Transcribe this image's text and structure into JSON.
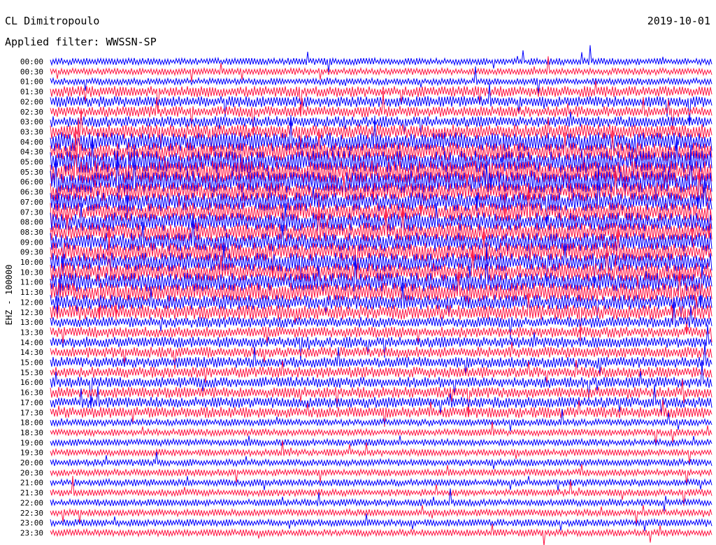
{
  "header": {
    "station": "CL Dimitropoulo",
    "filter": "Applied filter: WWSSN-SP",
    "date": "2019-10-01"
  },
  "chart_data": {
    "type": "line",
    "title": "CL Dimitropoulo",
    "subtitle": "Applied filter: WWSSN-SP",
    "ylabel": "EHZ - 100000",
    "date": "2019-10-01",
    "rows": [
      "00:00",
      "00:30",
      "01:00",
      "01:30",
      "02:00",
      "02:30",
      "03:00",
      "03:30",
      "04:00",
      "04:30",
      "05:00",
      "05:30",
      "06:00",
      "06:30",
      "07:00",
      "07:30",
      "08:00",
      "08:30",
      "09:00",
      "09:30",
      "10:00",
      "10:30",
      "11:00",
      "11:30",
      "12:00",
      "12:30",
      "13:00",
      "13:30",
      "14:00",
      "14:30",
      "15:00",
      "15:30",
      "16:00",
      "16:30",
      "17:00",
      "17:30",
      "18:00",
      "18:30",
      "19:00",
      "19:30",
      "20:00",
      "20:30",
      "21:00",
      "21:30",
      "22:00",
      "22:30",
      "23:00",
      "23:30"
    ],
    "row_amplitude_level": [
      1,
      1,
      1,
      2,
      2,
      2,
      2,
      3,
      4,
      4,
      5,
      5,
      5,
      4,
      4,
      4,
      4,
      4,
      4,
      4,
      4,
      4,
      4,
      4,
      3,
      3,
      2,
      2,
      2,
      2,
      2,
      2,
      2,
      2,
      2,
      2,
      1,
      1,
      1,
      1,
      1,
      1,
      1,
      1,
      1,
      1,
      1,
      1
    ],
    "series_colors": [
      "#0000ff",
      "#ff1744"
    ],
    "grid": false
  }
}
